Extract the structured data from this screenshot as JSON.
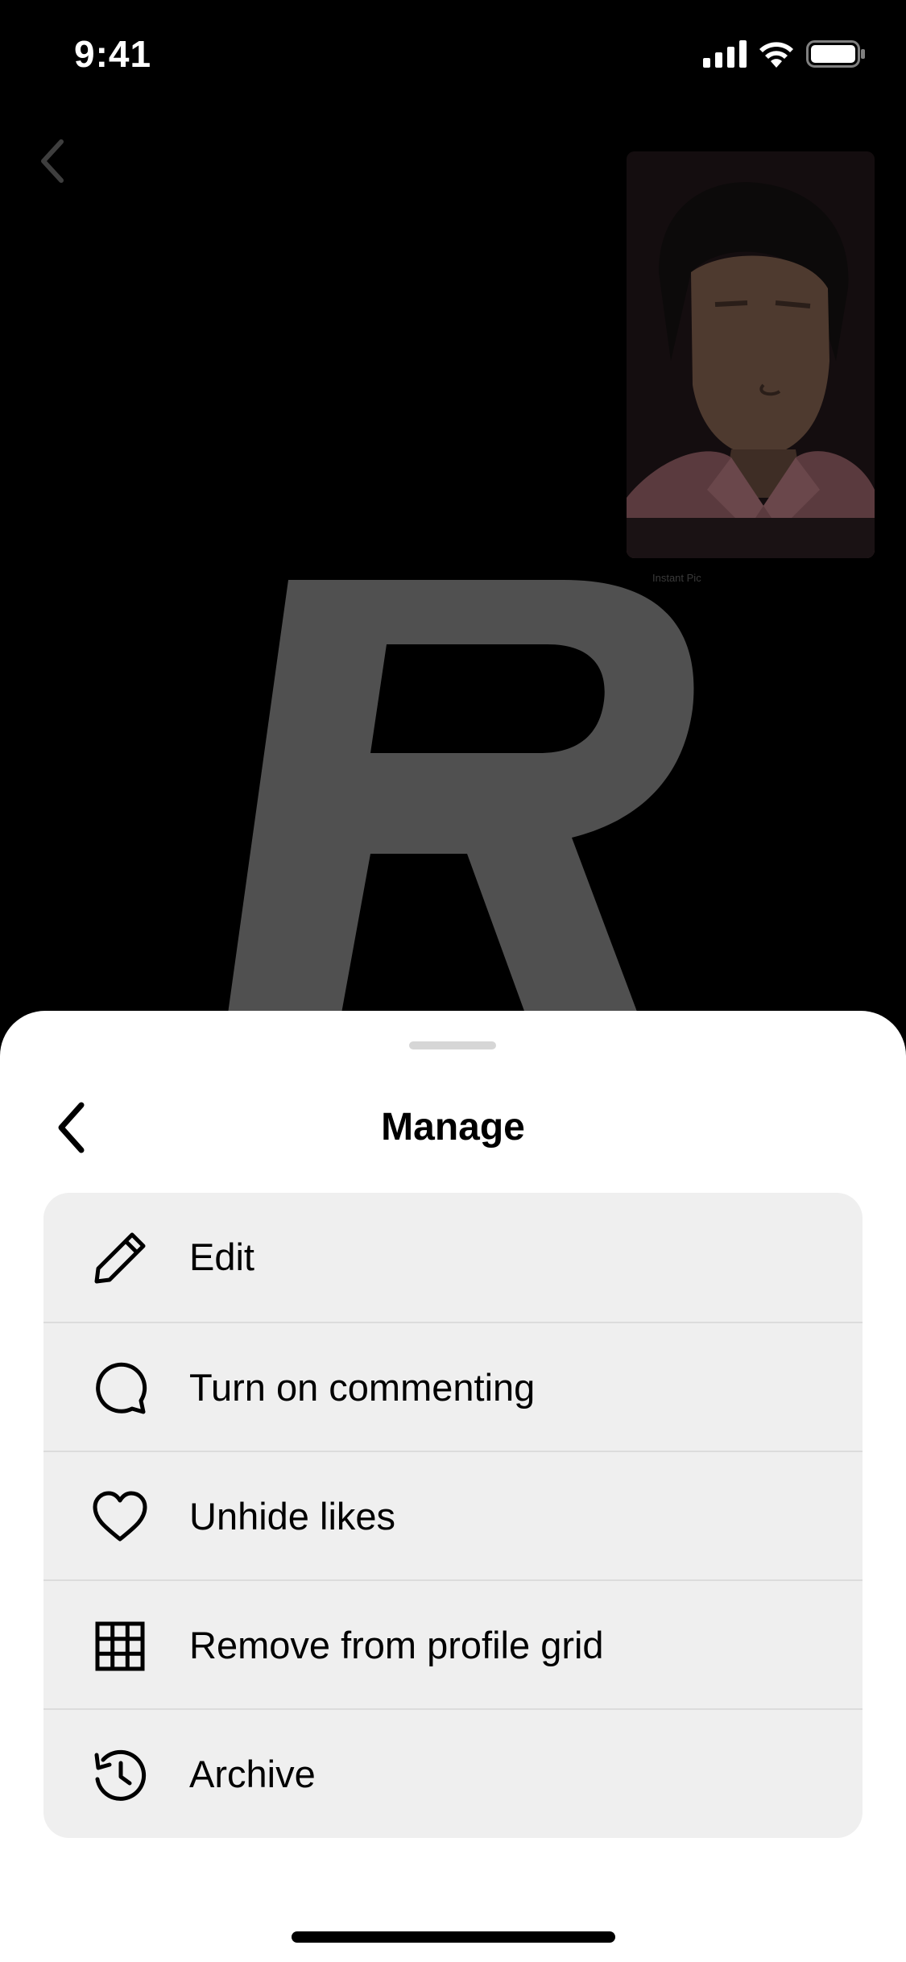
{
  "status_bar": {
    "time": "9:41",
    "icons": [
      "signal-icon",
      "wifi-icon",
      "battery-icon"
    ]
  },
  "background": {
    "letter": "R",
    "photo_caption": "Instant Pic"
  },
  "sheet": {
    "title": "Manage",
    "back_icon": "chevron-left-icon",
    "items": [
      {
        "label": "Edit",
        "icon": "pencil-icon"
      },
      {
        "label": "Turn on commenting",
        "icon": "comment-icon"
      },
      {
        "label": "Unhide likes",
        "icon": "heart-icon"
      },
      {
        "label": "Remove from profile grid",
        "icon": "grid-icon"
      },
      {
        "label": "Archive",
        "icon": "archive-history-icon"
      }
    ]
  },
  "colors": {
    "sheet_background": "#ffffff",
    "menu_background": "#efefef",
    "divider": "#dcdcdc",
    "backdrop": "#000000",
    "letter_gray": "#505050"
  }
}
